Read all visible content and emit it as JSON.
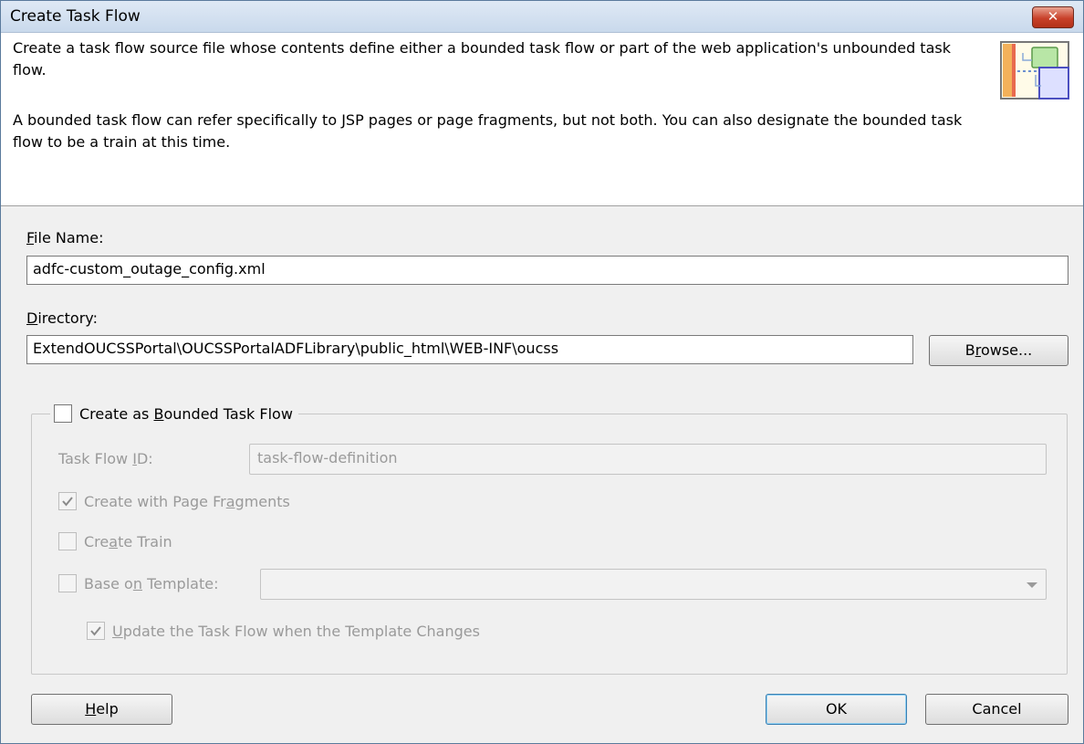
{
  "window": {
    "title": "Create Task Flow",
    "close_label": "✕"
  },
  "header": {
    "description_1": "Create a task flow source file whose contents define either a bounded task flow or part of the web application's unbounded task flow.",
    "description_2": "A bounded task flow can refer specifically to JSP pages or page fragments, but not both.  You can also designate the bounded task flow to be a train at this time."
  },
  "file_name": {
    "label_mnemonic": "F",
    "label_rest": "ile Name:",
    "value": "adfc-custom_outage_config.xml"
  },
  "directory": {
    "label_mnemonic": "D",
    "label_rest": "irectory:",
    "value": "ExtendOUCSSPortal\\OUCSSPortalADFLibrary\\public_html\\WEB-INF\\oucss",
    "browse_pre": "B",
    "browse_mnemonic": "r",
    "browse_post": "owse..."
  },
  "bounded": {
    "checkbox_pre": "Create as ",
    "checkbox_mnemonic": "B",
    "checkbox_post": "ounded Task Flow",
    "checked": false,
    "task_flow_id_pre": "Task Flow ",
    "task_flow_id_mnemonic": "I",
    "task_flow_id_post": "D:",
    "task_flow_id_value": "task-flow-definition",
    "page_fragments_pre": "Create with Page Fr",
    "page_fragments_mnemonic": "a",
    "page_fragments_post": "gments",
    "page_fragments_checked": true,
    "train_pre": "Cre",
    "train_mnemonic": "a",
    "train_post": "te Train",
    "train_checked": false,
    "template_pre": "Base o",
    "template_mnemonic": "n",
    "template_post": " Template:",
    "template_checked": false,
    "template_value": "",
    "update_mnemonic": "U",
    "update_post": "pdate the Task Flow when the Template Changes",
    "update_checked": true
  },
  "footer": {
    "help_mnemonic": "H",
    "help_post": "elp",
    "ok_label": "OK",
    "cancel_label": "Cancel"
  },
  "icons": [
    "close-icon",
    "task-flow-header-icon",
    "checkmark-icon",
    "dropdown-arrow-icon"
  ]
}
